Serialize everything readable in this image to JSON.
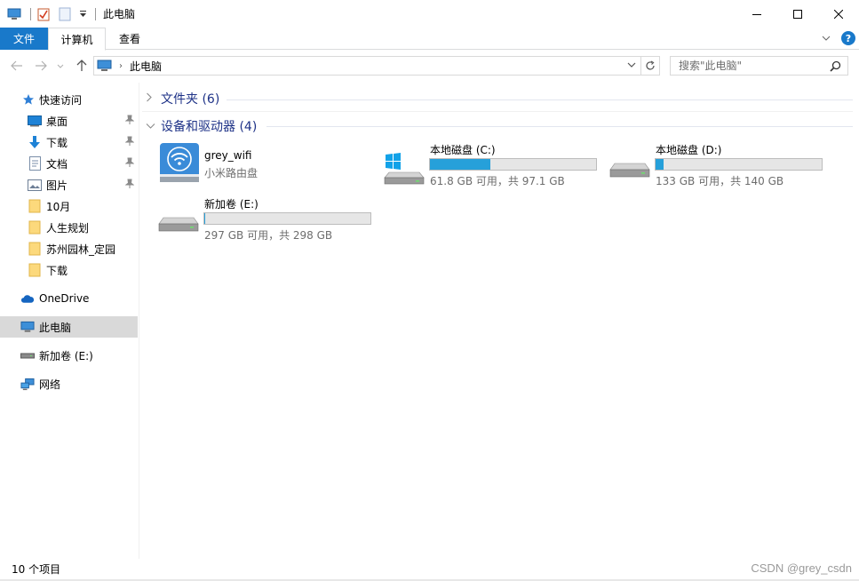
{
  "window": {
    "title": "此电脑"
  },
  "ribbon": {
    "tabs": [
      {
        "label": "文件"
      },
      {
        "label": "计算机"
      },
      {
        "label": "查看"
      }
    ]
  },
  "address": {
    "current": "此电脑",
    "search_placeholder": "搜索\"此电脑\""
  },
  "sidebar": {
    "quick_access": "快速访问",
    "items": [
      {
        "label": "桌面",
        "icon": "desktop-icon",
        "pinned": true
      },
      {
        "label": "下载",
        "icon": "download-icon",
        "pinned": true
      },
      {
        "label": "文档",
        "icon": "document-icon",
        "pinned": true
      },
      {
        "label": "图片",
        "icon": "picture-icon",
        "pinned": true
      },
      {
        "label": "10月",
        "icon": "folder-icon",
        "pinned": false
      },
      {
        "label": "人生规划",
        "icon": "folder-icon",
        "pinned": false
      },
      {
        "label": "苏州园林_定园",
        "icon": "folder-icon",
        "pinned": false
      },
      {
        "label": "下载",
        "icon": "folder-icon",
        "pinned": false
      }
    ],
    "onedrive": "OneDrive",
    "this_pc": "此电脑",
    "drive_e": "新加卷 (E:)",
    "network": "网络"
  },
  "main": {
    "folders_group": "文件夹 (6)",
    "devices_group": "设备和驱动器 (4)",
    "devices": [
      {
        "name": "grey_wifi",
        "sub": "小米路由盘",
        "icon": "router-disk-icon"
      },
      {
        "name": "本地磁盘 (C:)",
        "sub": "61.8 GB 可用，共 97.1 GB",
        "used_fraction": 0.364,
        "icon": "windows-drive-icon"
      },
      {
        "name": "本地磁盘 (D:)",
        "sub": "133 GB 可用，共 140 GB",
        "used_fraction": 0.05,
        "icon": "hard-drive-icon"
      },
      {
        "name": "新加卷 (E:)",
        "sub": "297 GB 可用，共 298 GB",
        "used_fraction": 0.003,
        "icon": "hard-drive-icon"
      }
    ]
  },
  "status": {
    "count": "10 个项目",
    "watermark": "CSDN @grey_csdn"
  },
  "colors": {
    "accent": "#1979ca",
    "bar_fill": "#26a0da",
    "group_text": "#1e3287"
  }
}
